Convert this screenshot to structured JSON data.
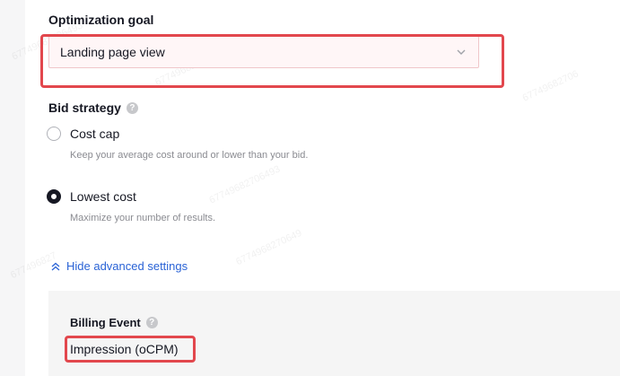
{
  "optimization_goal": {
    "label": "Optimization goal",
    "selected_value": "Landing page view"
  },
  "bid_strategy": {
    "label": "Bid strategy",
    "options": [
      {
        "label": "Cost cap",
        "description": "Keep your average cost around or lower than your bid.",
        "selected": false
      },
      {
        "label": "Lowest cost",
        "description": "Maximize your number of results.",
        "selected": true
      }
    ]
  },
  "advanced": {
    "toggle_label": "Hide advanced settings"
  },
  "billing_event": {
    "label": "Billing Event",
    "value": "Impression (oCPM)"
  },
  "colors": {
    "highlight": "#e2474d",
    "link": "#2a63d6"
  }
}
